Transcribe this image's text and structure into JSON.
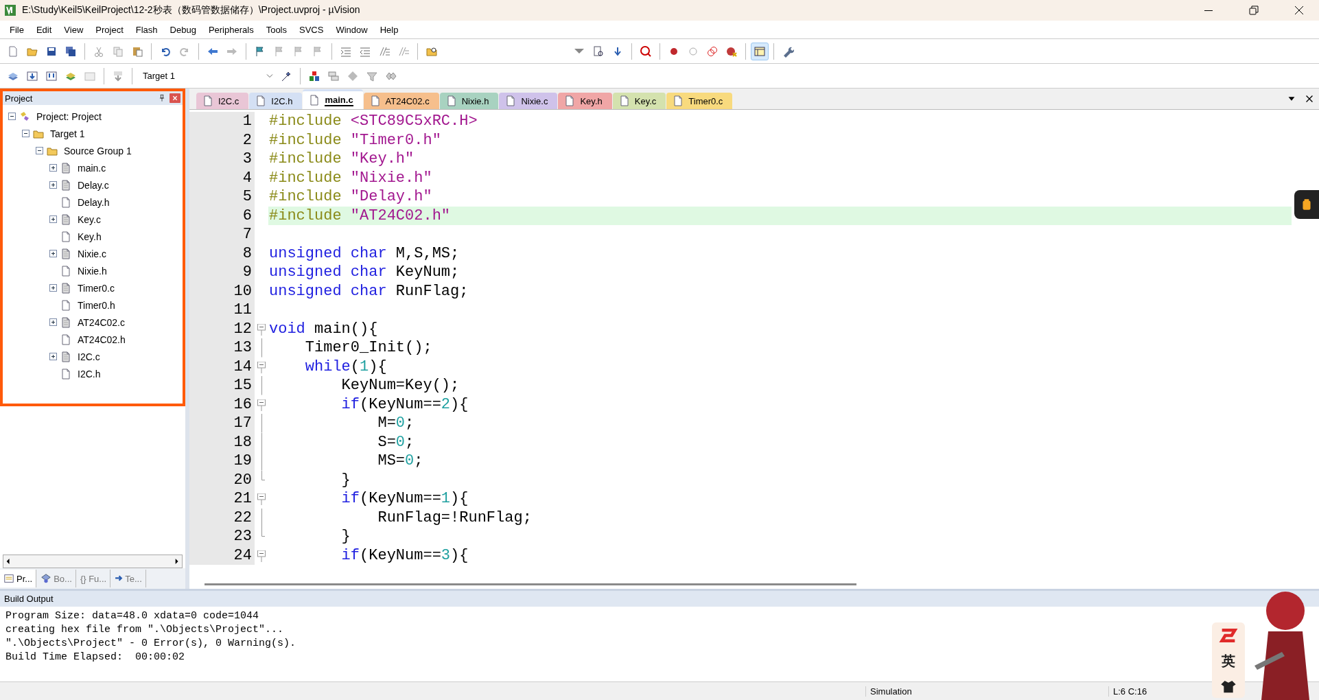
{
  "window": {
    "title": "E:\\Study\\Keil5\\KeilProject\\12-2秒表（数码管数据储存）\\Project.uvproj - µVision"
  },
  "menu": [
    "File",
    "Edit",
    "View",
    "Project",
    "Flash",
    "Debug",
    "Peripherals",
    "Tools",
    "SVCS",
    "Window",
    "Help"
  ],
  "target_select": {
    "value": "Target 1"
  },
  "project_panel": {
    "title": "Project",
    "highlighted": true,
    "tree": [
      {
        "label": "Project: Project",
        "kind": "project",
        "expanded": true,
        "children": [
          {
            "label": "Target 1",
            "kind": "target",
            "expanded": true,
            "children": [
              {
                "label": "Source Group 1",
                "kind": "group",
                "expanded": true,
                "children": [
                  {
                    "label": "main.c",
                    "kind": "c-file",
                    "expanded": false
                  },
                  {
                    "label": "Delay.c",
                    "kind": "c-file",
                    "expanded": false
                  },
                  {
                    "label": "Delay.h",
                    "kind": "h-file"
                  },
                  {
                    "label": "Key.c",
                    "kind": "c-file",
                    "expanded": false
                  },
                  {
                    "label": "Key.h",
                    "kind": "h-file"
                  },
                  {
                    "label": "Nixie.c",
                    "kind": "c-file",
                    "expanded": false
                  },
                  {
                    "label": "Nixie.h",
                    "kind": "h-file"
                  },
                  {
                    "label": "Timer0.c",
                    "kind": "c-file",
                    "expanded": false
                  },
                  {
                    "label": "Timer0.h",
                    "kind": "h-file"
                  },
                  {
                    "label": "AT24C02.c",
                    "kind": "c-file",
                    "expanded": false
                  },
                  {
                    "label": "AT24C02.h",
                    "kind": "h-file"
                  },
                  {
                    "label": "I2C.c",
                    "kind": "c-file",
                    "expanded": false
                  },
                  {
                    "label": "I2C.h",
                    "kind": "h-file"
                  }
                ]
              }
            ]
          }
        ]
      }
    ],
    "bottom_tabs": [
      {
        "label": "Pr...",
        "kind": "project",
        "selected": true
      },
      {
        "label": "Bo...",
        "kind": "books",
        "selected": false
      },
      {
        "label": "{} Fu...",
        "kind": "functions",
        "selected": false
      },
      {
        "label": "Te...",
        "kind": "templates",
        "selected": false
      }
    ]
  },
  "editor": {
    "tabs": [
      {
        "label": "I2C.c",
        "color": "#e9c6d6",
        "selected": false
      },
      {
        "label": "I2C.h",
        "color": "#d4e0f4",
        "selected": false
      },
      {
        "label": "main.c",
        "color": "#d4e0f4",
        "selected": true
      },
      {
        "label": "AT24C02.c",
        "color": "#f6bf8c",
        "selected": false
      },
      {
        "label": "Nixie.h",
        "color": "#a8d2c0",
        "selected": false
      },
      {
        "label": "Nixie.c",
        "color": "#cfc2ea",
        "selected": false
      },
      {
        "label": "Key.h",
        "color": "#f0a6a6",
        "selected": false
      },
      {
        "label": "Key.c",
        "color": "#d4e2ae",
        "selected": false
      },
      {
        "label": "Timer0.c",
        "color": "#f8da7e",
        "selected": false
      }
    ],
    "lines": [
      {
        "number": "1",
        "kind": "plain",
        "current": false,
        "tokens": [
          {
            "kind": "directive",
            "text": "#include "
          },
          {
            "kind": "string",
            "text": "<STC89C5xRC.H>"
          }
        ]
      },
      {
        "number": "2",
        "kind": "plain",
        "current": false,
        "tokens": [
          {
            "kind": "directive",
            "text": "#include "
          },
          {
            "kind": "string",
            "text": "\"Timer0.h\""
          }
        ]
      },
      {
        "number": "3",
        "kind": "plain",
        "current": false,
        "tokens": [
          {
            "kind": "directive",
            "text": "#include "
          },
          {
            "kind": "string",
            "text": "\"Key.h\""
          }
        ]
      },
      {
        "number": "4",
        "kind": "plain",
        "current": false,
        "tokens": [
          {
            "kind": "directive",
            "text": "#include "
          },
          {
            "kind": "string",
            "text": "\"Nixie.h\""
          }
        ]
      },
      {
        "number": "5",
        "kind": "plain",
        "current": false,
        "tokens": [
          {
            "kind": "directive",
            "text": "#include "
          },
          {
            "kind": "string",
            "text": "\"Delay.h\""
          }
        ]
      },
      {
        "number": "6",
        "kind": "plain",
        "current": true,
        "tokens": [
          {
            "kind": "directive",
            "text": "#include "
          },
          {
            "kind": "string",
            "text": "\"AT24C02.h\""
          }
        ]
      },
      {
        "number": "7",
        "kind": "plain",
        "current": false
      },
      {
        "number": "8",
        "kind": "plain",
        "current": false,
        "tokens": [
          {
            "kind": "keyword",
            "text": "unsigned char"
          },
          {
            "kind": "plain",
            "text": " M,S,MS;"
          }
        ]
      },
      {
        "number": "9",
        "kind": "plain",
        "current": false,
        "tokens": [
          {
            "kind": "keyword",
            "text": "unsigned char"
          },
          {
            "kind": "plain",
            "text": " KeyNum;"
          }
        ]
      },
      {
        "number": "10",
        "kind": "plain",
        "current": false,
        "tokens": [
          {
            "kind": "keyword",
            "text": "unsigned char"
          },
          {
            "kind": "plain",
            "text": " RunFlag;"
          }
        ]
      },
      {
        "number": "11",
        "kind": "plain",
        "current": false
      },
      {
        "number": "12",
        "kind": "fold-start",
        "current": false,
        "tokens": [
          {
            "kind": "keyword",
            "text": "void"
          },
          {
            "kind": "plain",
            "text": " main(){"
          }
        ]
      },
      {
        "number": "13",
        "kind": "fold-body",
        "current": false,
        "tokens": [
          {
            "kind": "plain",
            "text": "    Timer0_Init();"
          }
        ]
      },
      {
        "number": "14",
        "kind": "fold-start",
        "current": false,
        "tokens": [
          {
            "kind": "keyword",
            "text": "    while"
          },
          {
            "kind": "plain",
            "text": "("
          },
          {
            "kind": "number",
            "text": "1"
          },
          {
            "kind": "plain",
            "text": "){"
          }
        ]
      },
      {
        "number": "15",
        "kind": "fold-body",
        "current": false,
        "tokens": [
          {
            "kind": "plain",
            "text": "        KeyNum=Key();"
          }
        ]
      },
      {
        "number": "16",
        "kind": "fold-start",
        "current": false,
        "tokens": [
          {
            "kind": "keyword",
            "text": "        if"
          },
          {
            "kind": "plain",
            "text": "(KeyNum=="
          },
          {
            "kind": "number",
            "text": "2"
          },
          {
            "kind": "plain",
            "text": "){"
          }
        ]
      },
      {
        "number": "17",
        "kind": "fold-body",
        "current": false,
        "tokens": [
          {
            "kind": "plain",
            "text": "            M="
          },
          {
            "kind": "number",
            "text": "0"
          },
          {
            "kind": "plain",
            "text": ";"
          }
        ]
      },
      {
        "number": "18",
        "kind": "fold-body",
        "current": false,
        "tokens": [
          {
            "kind": "plain",
            "text": "            S="
          },
          {
            "kind": "number",
            "text": "0"
          },
          {
            "kind": "plain",
            "text": ";"
          }
        ]
      },
      {
        "number": "19",
        "kind": "fold-body",
        "current": false,
        "tokens": [
          {
            "kind": "plain",
            "text": "            MS="
          },
          {
            "kind": "number",
            "text": "0"
          },
          {
            "kind": "plain",
            "text": ";"
          }
        ]
      },
      {
        "number": "20",
        "kind": "fold-end",
        "current": false,
        "tokens": [
          {
            "kind": "plain",
            "text": "        }"
          }
        ]
      },
      {
        "number": "21",
        "kind": "fold-start",
        "current": false,
        "tokens": [
          {
            "kind": "keyword",
            "text": "        if"
          },
          {
            "kind": "plain",
            "text": "(KeyNum=="
          },
          {
            "kind": "number",
            "text": "1"
          },
          {
            "kind": "plain",
            "text": "){"
          }
        ]
      },
      {
        "number": "22",
        "kind": "fold-body",
        "current": false,
        "tokens": [
          {
            "kind": "plain",
            "text": "            RunFlag=!RunFlag;"
          }
        ]
      },
      {
        "number": "23",
        "kind": "fold-end",
        "current": false,
        "tokens": [
          {
            "kind": "plain",
            "text": "        }"
          }
        ]
      },
      {
        "number": "24",
        "kind": "fold-start",
        "current": false,
        "tokens": [
          {
            "kind": "keyword",
            "text": "        if"
          },
          {
            "kind": "plain",
            "text": "(KeyNum=="
          },
          {
            "kind": "number",
            "text": "3"
          },
          {
            "kind": "plain",
            "text": "){"
          }
        ]
      }
    ]
  },
  "build_output": {
    "title": "Build Output",
    "lines": [
      "Program Size: data=48.0 xdata=0 code=1044",
      "creating hex file from \".\\Objects\\Project\"...",
      "\".\\Objects\\Project\" - 0 Error(s), 0 Warning(s).",
      "Build Time Elapsed:  00:00:02"
    ]
  },
  "status_bar": {
    "mode": "Simulation",
    "position": "L:6 C:16"
  },
  "ime_badge": {
    "mode": "英"
  }
}
